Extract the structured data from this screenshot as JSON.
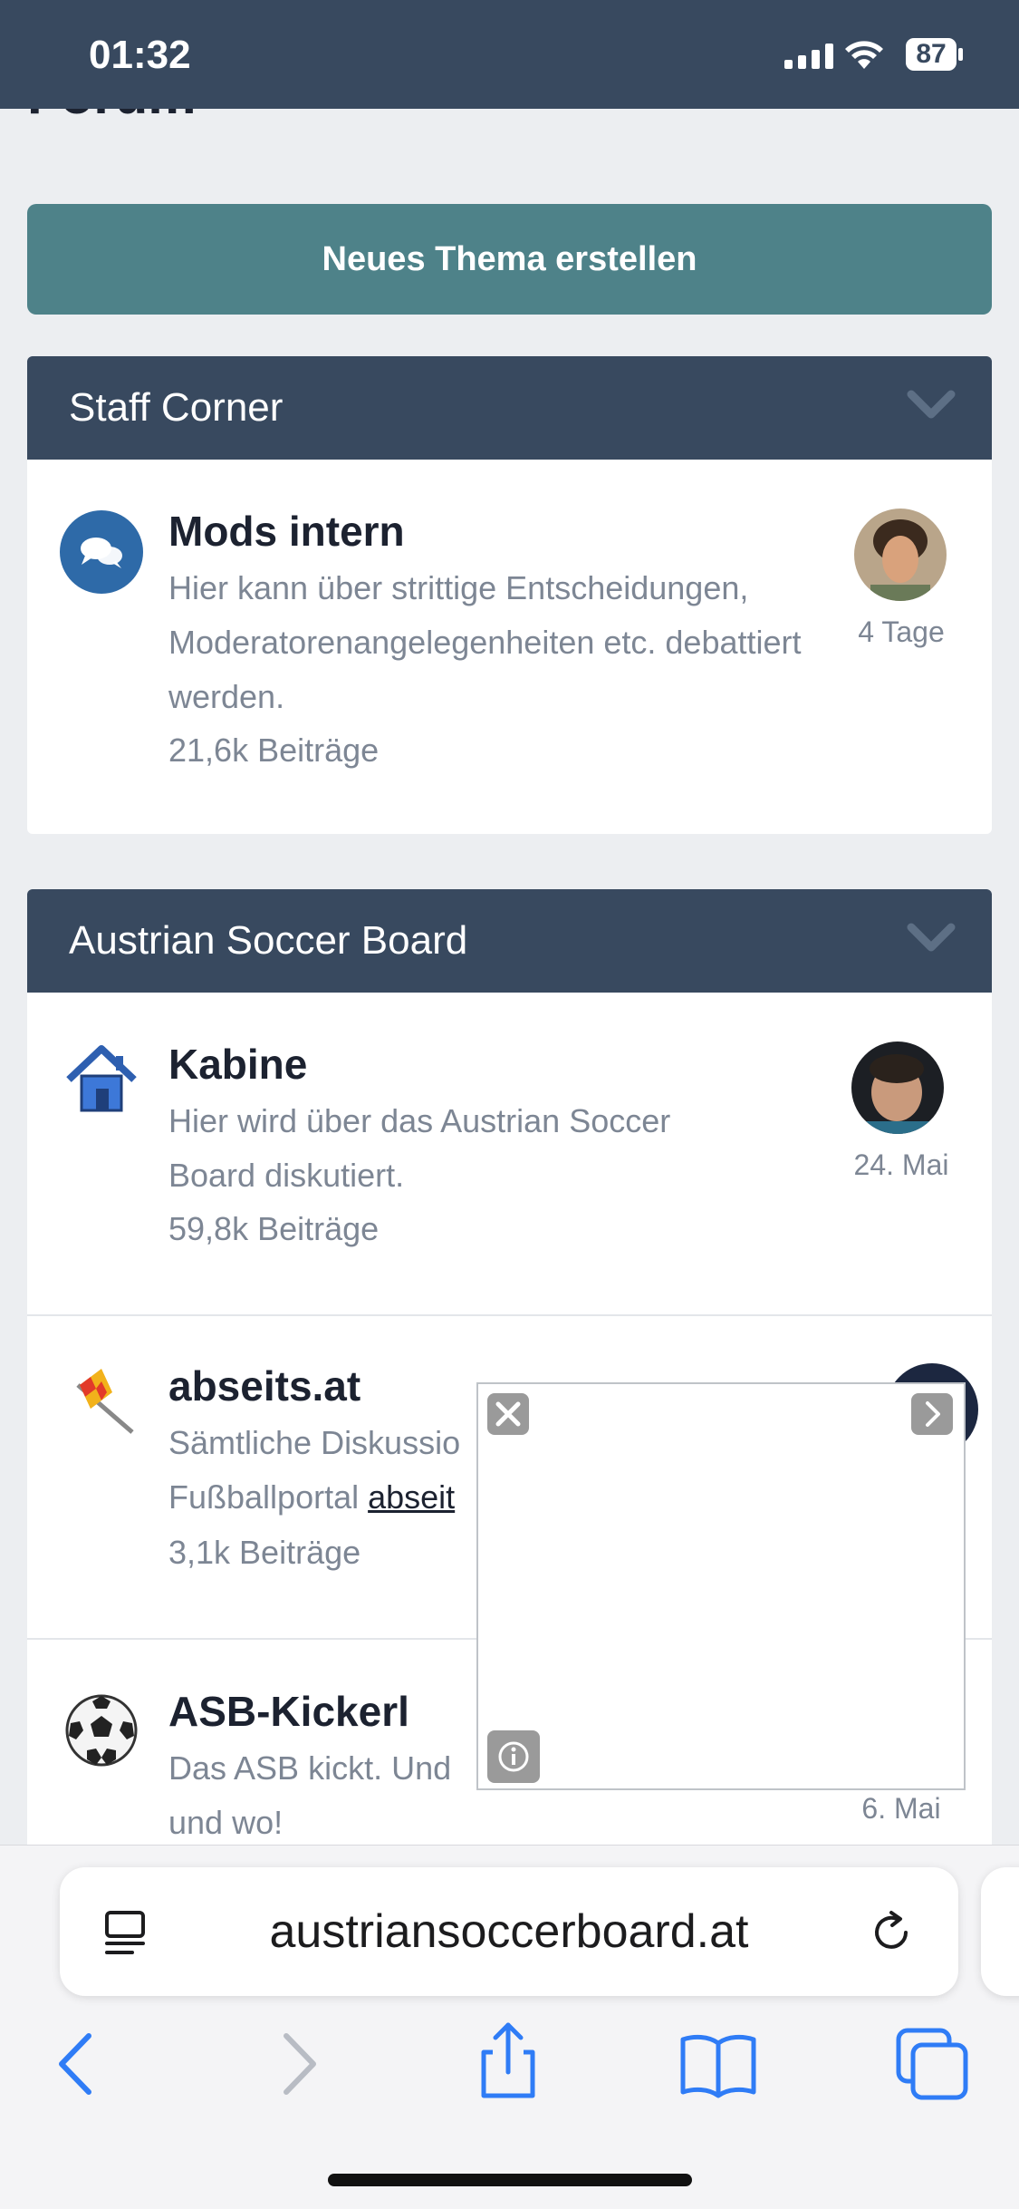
{
  "status": {
    "time": "01:32",
    "battery": "87"
  },
  "page": {
    "title": "Forum",
    "new_topic_label": "Neues Thema erstellen"
  },
  "categories": [
    {
      "title": "Staff Corner"
    },
    {
      "title": "Austrian Soccer Board"
    }
  ],
  "forums": [
    {
      "name": "Mods intern",
      "description": "Hier kann über strittige Entscheidungen, Moderatorenangelegenheiten etc. debattiert werden.",
      "stats": "21,6k Beiträge",
      "last_post": "4 Tage"
    },
    {
      "name": "Kabine",
      "description": "Hier wird über das Austrian Soccer Board diskutiert.",
      "stats": "59,8k Beiträge",
      "last_post": "24. Mai"
    },
    {
      "name": "abseits.at",
      "description_pre": "Sämtliche Diskussio",
      "description_line2": "Fußballportal ",
      "description_link": "abseit",
      "stats": "3,1k Beiträge"
    },
    {
      "name": "ASB-Kickerl",
      "description": "Das ASB kickt. Und",
      "description_line2": "und wo!",
      "last_post": "6. Mai"
    }
  ],
  "browser": {
    "url": "austriansoccerboard.at"
  },
  "colors": {
    "header": "#38495f",
    "button": "#4e8289",
    "ios_blue": "#2f7cf6"
  }
}
